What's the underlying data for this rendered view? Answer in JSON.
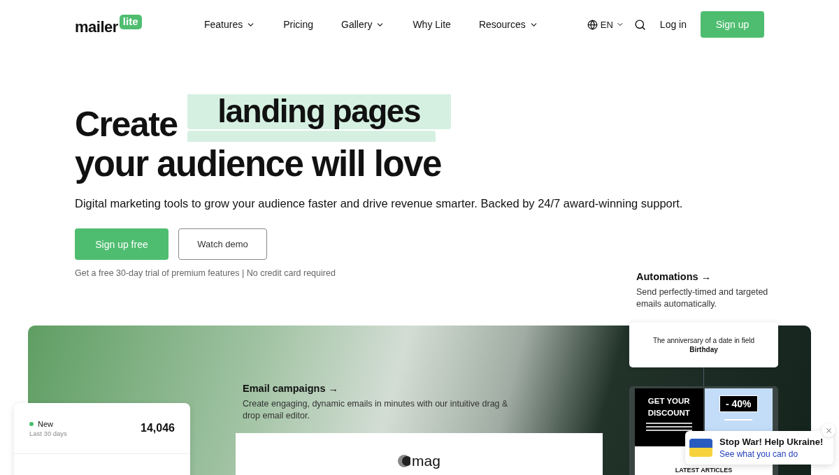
{
  "nav": {
    "logo": {
      "word": "mailer",
      "badge": "lite"
    },
    "links": [
      {
        "label": "Features",
        "dropdown": true
      },
      {
        "label": "Pricing",
        "dropdown": false
      },
      {
        "label": "Gallery",
        "dropdown": true
      },
      {
        "label": "Why Lite",
        "dropdown": false
      },
      {
        "label": "Resources",
        "dropdown": true
      }
    ],
    "language": "EN",
    "login": "Log in",
    "signup": "Sign up"
  },
  "hero": {
    "headline_start": "Create",
    "rotating_word": "landing pages",
    "headline_end": "your audience will love",
    "subtitle": "Digital marketing tools to grow your audience faster and drive revenue smarter. Backed by 24/7 award-winning support.",
    "primary_button": "Sign up free",
    "secondary_button": "Watch demo",
    "note": "Get a free 30-day trial of premium features | No credit card required"
  },
  "automations": {
    "title": "Automations →",
    "description": "Send perfectly-timed and targeted emails automatically."
  },
  "email_campaigns": {
    "title": "Email campaigns →",
    "description": "Create engaging, dynamic emails in minutes with our intuitive drag & drop email editor."
  },
  "stats_card": {
    "status": "New",
    "color": "#4cbf68",
    "period": "Last 30 days",
    "value": "14,046"
  },
  "trigger_card": {
    "text": "The anniversary of a date in field **Birthday**"
  },
  "discount_email": {
    "heading": "GET YOUR DISCOUNT",
    "discount": "- 40%",
    "articles": "LATEST ARTICLES"
  },
  "magazine_preview": {
    "logo": "mag"
  },
  "ukraine_banner": {
    "title": "Stop War! Help Ukraine!",
    "link": "See what you can do"
  }
}
